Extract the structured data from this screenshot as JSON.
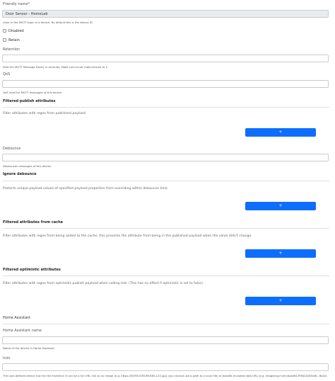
{
  "friendly_name": {
    "label": "Friendly name*",
    "value": "Door Sensor - HomeLab",
    "help": "Used in the MQTT topic of a device. By default this is the device ID"
  },
  "disabled": {
    "label": "Disabled"
  },
  "retain": {
    "label": "Retain"
  },
  "retention": {
    "label": "Retention",
    "help": "Sets the MQTT Message Expiry in seconds, Make sure to set mqtt.version to 5"
  },
  "qos": {
    "label": "QoS",
    "help": "QoS level for MQTT messages of this device"
  },
  "filtered_publish": {
    "title": "Filtered publish attributes",
    "description": "Filter attributes with regex from published payload.",
    "add_label": "+"
  },
  "debounce": {
    "label": "Debounce",
    "help": "Debounces messages of this device"
  },
  "ignore_debounce": {
    "title": "Ignore debounce",
    "description": "Protects unique payload values of specified payload properties from overriding within debounce time",
    "add_label": "+"
  },
  "filtered_cache": {
    "title": "Filtered attributes from cache",
    "description": "Filter attributes with regex from being added to the cache, this prevents the attribute from being in the published payload when the value didn't change.",
    "add_label": "+"
  },
  "filtered_optimistic": {
    "title": "Filtered optimistic attributes",
    "description": "Filter attributes with regex from optimistic publish payload when calling /set. (This has no effect if optimistic is set to false).",
    "add_label": "+"
  },
  "home_assistant": {
    "title": "Home Assistant",
    "name_label": "Home Assistant name",
    "name_help": "Name of the device in Home Assistant",
    "icon_label": "Icon",
    "icon_help": "The user-defined device icon for the frontend. It can be a full URL link to an image (e.g. https://SOME.SITE/MODEL123.jpg) (you cannot use a path to a local file) or base64 encoded data URL (e.g. image/svg+xml;base64,PHN2ZyB3aW...RoZz)"
  }
}
